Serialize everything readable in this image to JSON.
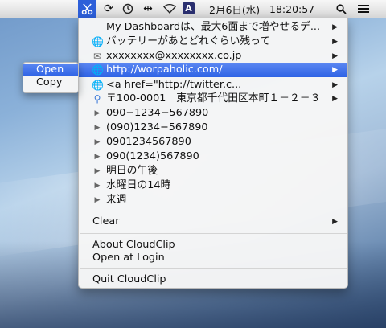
{
  "menubar": {
    "app_icon": "scissors-icon",
    "status_icons": [
      "sync-icon",
      "clock-icon",
      "arrows-icon",
      "wifi-icon",
      "volume-icon"
    ],
    "input_method": "A",
    "date": "2月6日(水)",
    "time": "18:20:57",
    "search_icon": "magnifier-icon",
    "list_icon": "list-icon"
  },
  "menu": {
    "items": [
      {
        "label": "My Dashboardは、最大6面まで増やせるデ...",
        "icon": "none",
        "arrow": "▶"
      },
      {
        "label": "バッテリーがあとどれぐらい残って",
        "icon": "globe",
        "arrow": "▶"
      },
      {
        "label": "xxxxxxxx@xxxxxxxx.co.jp",
        "icon": "envelope",
        "arrow": "▶"
      },
      {
        "label": "http://worpaholic.com/",
        "icon": "globe",
        "arrow": "▶"
      },
      {
        "label": "<a href=\"http://twitter.c...",
        "icon": "globe",
        "arrow": "▶"
      },
      {
        "label": "〒100-0001　東京都千代田区本町１－２－３",
        "icon": "pin",
        "arrow": "▶"
      },
      {
        "label": "090−1234−567890",
        "icon": "triangle",
        "arrow": ""
      },
      {
        "label": "(090)1234−567890",
        "icon": "triangle",
        "arrow": ""
      },
      {
        "label": "0901234567890",
        "icon": "triangle",
        "arrow": ""
      },
      {
        "label": "090(1234)567890",
        "icon": "triangle",
        "arrow": ""
      },
      {
        "label": "明日の午後",
        "icon": "triangle",
        "arrow": ""
      },
      {
        "label": "水曜日の14時",
        "icon": "triangle",
        "arrow": ""
      },
      {
        "label": "来週",
        "icon": "triangle",
        "arrow": ""
      }
    ],
    "clear_label": "Clear",
    "about_label": "About CloudClip",
    "login_label": "Open at Login",
    "quit_label": "Quit CloudClip"
  },
  "submenu": {
    "open_label": "Open",
    "copy_label": "Copy"
  },
  "colors": {
    "selection": "#2e63e5",
    "menubar_active": "#2d5fd9"
  }
}
